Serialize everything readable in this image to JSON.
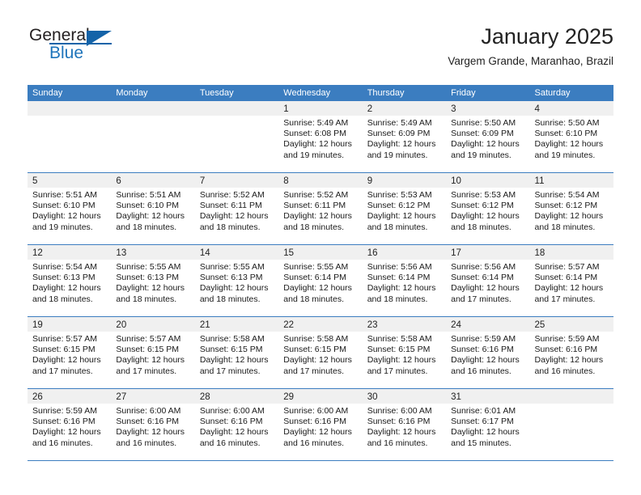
{
  "brand": {
    "name_part1": "General",
    "name_part2": "Blue",
    "logo_icon": "triangle-logo-icon"
  },
  "header": {
    "month_title": "January 2025",
    "location": "Vargem Grande, Maranhao, Brazil"
  },
  "colors": {
    "header_blue": "#3b7dc0",
    "brand_blue": "#1463a8",
    "date_strip": "#f0f0f0"
  },
  "calendar": {
    "weekdays": [
      "Sunday",
      "Monday",
      "Tuesday",
      "Wednesday",
      "Thursday",
      "Friday",
      "Saturday"
    ],
    "weeks": [
      [
        {
          "day": "",
          "empty": true
        },
        {
          "day": "",
          "empty": true
        },
        {
          "day": "",
          "empty": true
        },
        {
          "day": "1",
          "sunrise": "Sunrise: 5:49 AM",
          "sunset": "Sunset: 6:08 PM",
          "daylight1": "Daylight: 12 hours",
          "daylight2": "and 19 minutes."
        },
        {
          "day": "2",
          "sunrise": "Sunrise: 5:49 AM",
          "sunset": "Sunset: 6:09 PM",
          "daylight1": "Daylight: 12 hours",
          "daylight2": "and 19 minutes."
        },
        {
          "day": "3",
          "sunrise": "Sunrise: 5:50 AM",
          "sunset": "Sunset: 6:09 PM",
          "daylight1": "Daylight: 12 hours",
          "daylight2": "and 19 minutes."
        },
        {
          "day": "4",
          "sunrise": "Sunrise: 5:50 AM",
          "sunset": "Sunset: 6:10 PM",
          "daylight1": "Daylight: 12 hours",
          "daylight2": "and 19 minutes."
        }
      ],
      [
        {
          "day": "5",
          "sunrise": "Sunrise: 5:51 AM",
          "sunset": "Sunset: 6:10 PM",
          "daylight1": "Daylight: 12 hours",
          "daylight2": "and 19 minutes."
        },
        {
          "day": "6",
          "sunrise": "Sunrise: 5:51 AM",
          "sunset": "Sunset: 6:10 PM",
          "daylight1": "Daylight: 12 hours",
          "daylight2": "and 18 minutes."
        },
        {
          "day": "7",
          "sunrise": "Sunrise: 5:52 AM",
          "sunset": "Sunset: 6:11 PM",
          "daylight1": "Daylight: 12 hours",
          "daylight2": "and 18 minutes."
        },
        {
          "day": "8",
          "sunrise": "Sunrise: 5:52 AM",
          "sunset": "Sunset: 6:11 PM",
          "daylight1": "Daylight: 12 hours",
          "daylight2": "and 18 minutes."
        },
        {
          "day": "9",
          "sunrise": "Sunrise: 5:53 AM",
          "sunset": "Sunset: 6:12 PM",
          "daylight1": "Daylight: 12 hours",
          "daylight2": "and 18 minutes."
        },
        {
          "day": "10",
          "sunrise": "Sunrise: 5:53 AM",
          "sunset": "Sunset: 6:12 PM",
          "daylight1": "Daylight: 12 hours",
          "daylight2": "and 18 minutes."
        },
        {
          "day": "11",
          "sunrise": "Sunrise: 5:54 AM",
          "sunset": "Sunset: 6:12 PM",
          "daylight1": "Daylight: 12 hours",
          "daylight2": "and 18 minutes."
        }
      ],
      [
        {
          "day": "12",
          "sunrise": "Sunrise: 5:54 AM",
          "sunset": "Sunset: 6:13 PM",
          "daylight1": "Daylight: 12 hours",
          "daylight2": "and 18 minutes."
        },
        {
          "day": "13",
          "sunrise": "Sunrise: 5:55 AM",
          "sunset": "Sunset: 6:13 PM",
          "daylight1": "Daylight: 12 hours",
          "daylight2": "and 18 minutes."
        },
        {
          "day": "14",
          "sunrise": "Sunrise: 5:55 AM",
          "sunset": "Sunset: 6:13 PM",
          "daylight1": "Daylight: 12 hours",
          "daylight2": "and 18 minutes."
        },
        {
          "day": "15",
          "sunrise": "Sunrise: 5:55 AM",
          "sunset": "Sunset: 6:14 PM",
          "daylight1": "Daylight: 12 hours",
          "daylight2": "and 18 minutes."
        },
        {
          "day": "16",
          "sunrise": "Sunrise: 5:56 AM",
          "sunset": "Sunset: 6:14 PM",
          "daylight1": "Daylight: 12 hours",
          "daylight2": "and 18 minutes."
        },
        {
          "day": "17",
          "sunrise": "Sunrise: 5:56 AM",
          "sunset": "Sunset: 6:14 PM",
          "daylight1": "Daylight: 12 hours",
          "daylight2": "and 17 minutes."
        },
        {
          "day": "18",
          "sunrise": "Sunrise: 5:57 AM",
          "sunset": "Sunset: 6:14 PM",
          "daylight1": "Daylight: 12 hours",
          "daylight2": "and 17 minutes."
        }
      ],
      [
        {
          "day": "19",
          "sunrise": "Sunrise: 5:57 AM",
          "sunset": "Sunset: 6:15 PM",
          "daylight1": "Daylight: 12 hours",
          "daylight2": "and 17 minutes."
        },
        {
          "day": "20",
          "sunrise": "Sunrise: 5:57 AM",
          "sunset": "Sunset: 6:15 PM",
          "daylight1": "Daylight: 12 hours",
          "daylight2": "and 17 minutes."
        },
        {
          "day": "21",
          "sunrise": "Sunrise: 5:58 AM",
          "sunset": "Sunset: 6:15 PM",
          "daylight1": "Daylight: 12 hours",
          "daylight2": "and 17 minutes."
        },
        {
          "day": "22",
          "sunrise": "Sunrise: 5:58 AM",
          "sunset": "Sunset: 6:15 PM",
          "daylight1": "Daylight: 12 hours",
          "daylight2": "and 17 minutes."
        },
        {
          "day": "23",
          "sunrise": "Sunrise: 5:58 AM",
          "sunset": "Sunset: 6:15 PM",
          "daylight1": "Daylight: 12 hours",
          "daylight2": "and 17 minutes."
        },
        {
          "day": "24",
          "sunrise": "Sunrise: 5:59 AM",
          "sunset": "Sunset: 6:16 PM",
          "daylight1": "Daylight: 12 hours",
          "daylight2": "and 16 minutes."
        },
        {
          "day": "25",
          "sunrise": "Sunrise: 5:59 AM",
          "sunset": "Sunset: 6:16 PM",
          "daylight1": "Daylight: 12 hours",
          "daylight2": "and 16 minutes."
        }
      ],
      [
        {
          "day": "26",
          "sunrise": "Sunrise: 5:59 AM",
          "sunset": "Sunset: 6:16 PM",
          "daylight1": "Daylight: 12 hours",
          "daylight2": "and 16 minutes."
        },
        {
          "day": "27",
          "sunrise": "Sunrise: 6:00 AM",
          "sunset": "Sunset: 6:16 PM",
          "daylight1": "Daylight: 12 hours",
          "daylight2": "and 16 minutes."
        },
        {
          "day": "28",
          "sunrise": "Sunrise: 6:00 AM",
          "sunset": "Sunset: 6:16 PM",
          "daylight1": "Daylight: 12 hours",
          "daylight2": "and 16 minutes."
        },
        {
          "day": "29",
          "sunrise": "Sunrise: 6:00 AM",
          "sunset": "Sunset: 6:16 PM",
          "daylight1": "Daylight: 12 hours",
          "daylight2": "and 16 minutes."
        },
        {
          "day": "30",
          "sunrise": "Sunrise: 6:00 AM",
          "sunset": "Sunset: 6:16 PM",
          "daylight1": "Daylight: 12 hours",
          "daylight2": "and 16 minutes."
        },
        {
          "day": "31",
          "sunrise": "Sunrise: 6:01 AM",
          "sunset": "Sunset: 6:17 PM",
          "daylight1": "Daylight: 12 hours",
          "daylight2": "and 15 minutes."
        },
        {
          "day": "",
          "empty": true
        }
      ]
    ]
  }
}
